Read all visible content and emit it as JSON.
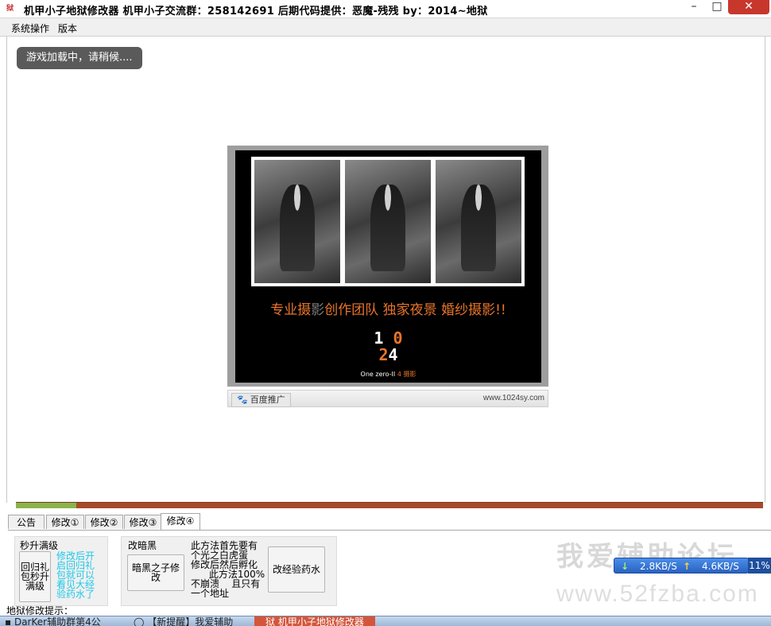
{
  "window": {
    "app_icon_glyph": "狱",
    "title": "机甲小子地狱修改器   机甲小子交流群：258142691   后期代码提供：恶魔-残残  by：2014~地狱",
    "controls": {
      "minimize": "–",
      "maximize": "□",
      "close": "✕"
    }
  },
  "menu": {
    "items": [
      "系统操作",
      "版本"
    ]
  },
  "browser": {
    "loading_text": "游戏加载中，请稍候....",
    "ad": {
      "tagline_a": "专业摄",
      "tagline_b": "影",
      "tagline_c": "创作团队  独家夜景  婚纱摄影!!",
      "logo_top_white": "1",
      "logo_top_orange": "0",
      "logo_bottom_orange": "2",
      "logo_bottom_white": "4",
      "sub_white": "One zero-II ",
      "sub_orange": "4 摄影",
      "badge_icon": "paw-icon",
      "badge_text": "百度推广",
      "url": "www.1024sy.com"
    }
  },
  "progress": {
    "fraction": 0.081,
    "fill_color": "#8ab44a",
    "track_color": "#a84a2a"
  },
  "tabs": [
    {
      "label": "公告",
      "active": false
    },
    {
      "label": "修改①",
      "active": false
    },
    {
      "label": "修改②",
      "active": false
    },
    {
      "label": "修改③",
      "active": false
    },
    {
      "label": "修改④",
      "active": true
    }
  ],
  "panel": {
    "group1": {
      "title": "秒升满级",
      "button_l1": "回归礼",
      "button_l2": "包秒升",
      "button_l3": "满级",
      "note": [
        "修改后开",
        "启回归礼",
        "包就可以",
        "看见大经",
        "验药水了"
      ]
    },
    "group2": {
      "title": "改暗黑",
      "button_l1": "暗黑之子修",
      "button_l2": "改",
      "desc": [
        "此方法首先要有",
        "个光之白虎蛋",
        "修改后然后孵化",
        "      此方法100%",
        "不崩溃    且只有",
        "一个地址"
      ],
      "button2": "改经验药水"
    }
  },
  "network": {
    "down_icon": "arrow-down-icon",
    "down_speed": "2.8KB/S",
    "up_icon": "arrow-up-icon",
    "up_speed": "4.6KB/S",
    "percent": "11%"
  },
  "watermark": {
    "line1": "我爱辅助论坛",
    "line2": "www.52fzba.com"
  },
  "status_hint": "地狱修改提示：",
  "taskbar": {
    "items": [
      "DarKer辅助群第4公",
      "【新提醒】我爱辅助",
      "机甲小子地狱修改器"
    ]
  }
}
